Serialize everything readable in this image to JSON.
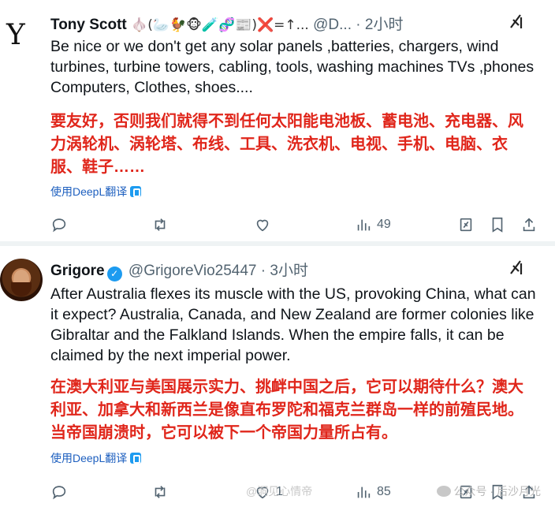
{
  "tweets": [
    {
      "name": "Tony Scott",
      "emojis": "🧄(🦢🐓🐵🧪🧬📰)❌=↑...",
      "handle": "@D...",
      "dot": "·",
      "time": "2小时",
      "text_en": "Be nice or we don't get any solar panels ,batteries, chargers, wind turbines, turbine towers, cabling, tools, washing machines TVs ,phones  Computers, Clothes, shoes....",
      "text_zh": "要友好，否则我们就得不到任何太阳能电池板、蓄电池、充电器、风力涡轮机、涡轮塔、布线、工具、洗衣机、电视、手机、电脑、衣服、鞋子……",
      "translate_label": "使用DeepL翻译",
      "views": "49"
    },
    {
      "name": "Grigore",
      "handle": "@GrigoreVio25447",
      "dot": "·",
      "time": "3小时",
      "text_en": "After Australia flexes its muscle with the US, provoking China, what can it expect? Australia, Canada, and New Zealand are former colonies like Gibraltar and the Falkland Islands. When the empire falls, it can be claimed by the next imperial power.",
      "text_zh": "在澳大利亚与美国展示实力、挑衅中国之后，它可以期待什么？澳大利亚、加拿大和新西兰是像直布罗陀和福克兰群岛一样的前殖民地。当帝国崩溃时，它可以被下一个帝国力量所占有。",
      "translate_label": "使用DeepL翻译",
      "likes": "1",
      "views": "85"
    }
  ],
  "watermark": "公众号 · 后沙月光",
  "watermark_weibo": "@洞见心情帝",
  "colors": {
    "translation_text": "#e0261b",
    "link": "#1d5fbf",
    "verified": "#1d9bf0",
    "muted": "#536471"
  }
}
